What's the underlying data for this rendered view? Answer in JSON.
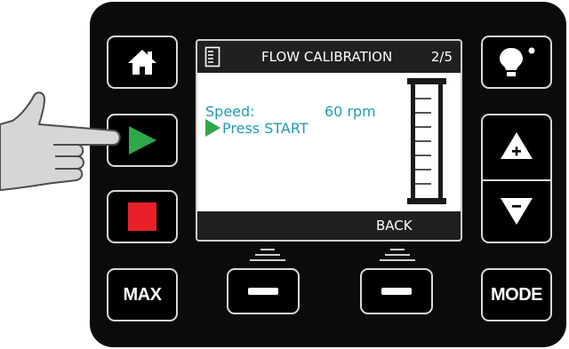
{
  "screen": {
    "header": {
      "icon": "measuring-cylinder-icon",
      "title": "FLOW CALIBRATION",
      "page": "2/5"
    },
    "speed_label": "Speed:",
    "speed_value": "60 rpm",
    "prompt": "Press START",
    "footer": {
      "center_label": "BACK"
    }
  },
  "buttons": {
    "home": {
      "icon": "home-icon"
    },
    "start": {
      "icon": "play-icon",
      "color": "#2ea84a"
    },
    "stop": {
      "icon": "stop-icon",
      "color": "#e8202a"
    },
    "max": {
      "label": "MAX"
    },
    "soft_left": {
      "icon": "minus-icon"
    },
    "soft_right": {
      "icon": "minus-icon"
    },
    "light": {
      "icon": "lightbulb-icon"
    },
    "up": {
      "icon": "up-plus-icon"
    },
    "down": {
      "icon": "down-minus-icon"
    },
    "mode": {
      "label": "MODE"
    }
  },
  "pointer": {
    "icon": "pointing-hand-icon"
  },
  "colors": {
    "panel": "#0b0b0b",
    "accent_text": "#1f9bb3",
    "start_green": "#2ea84a",
    "stop_red": "#e8202a"
  }
}
